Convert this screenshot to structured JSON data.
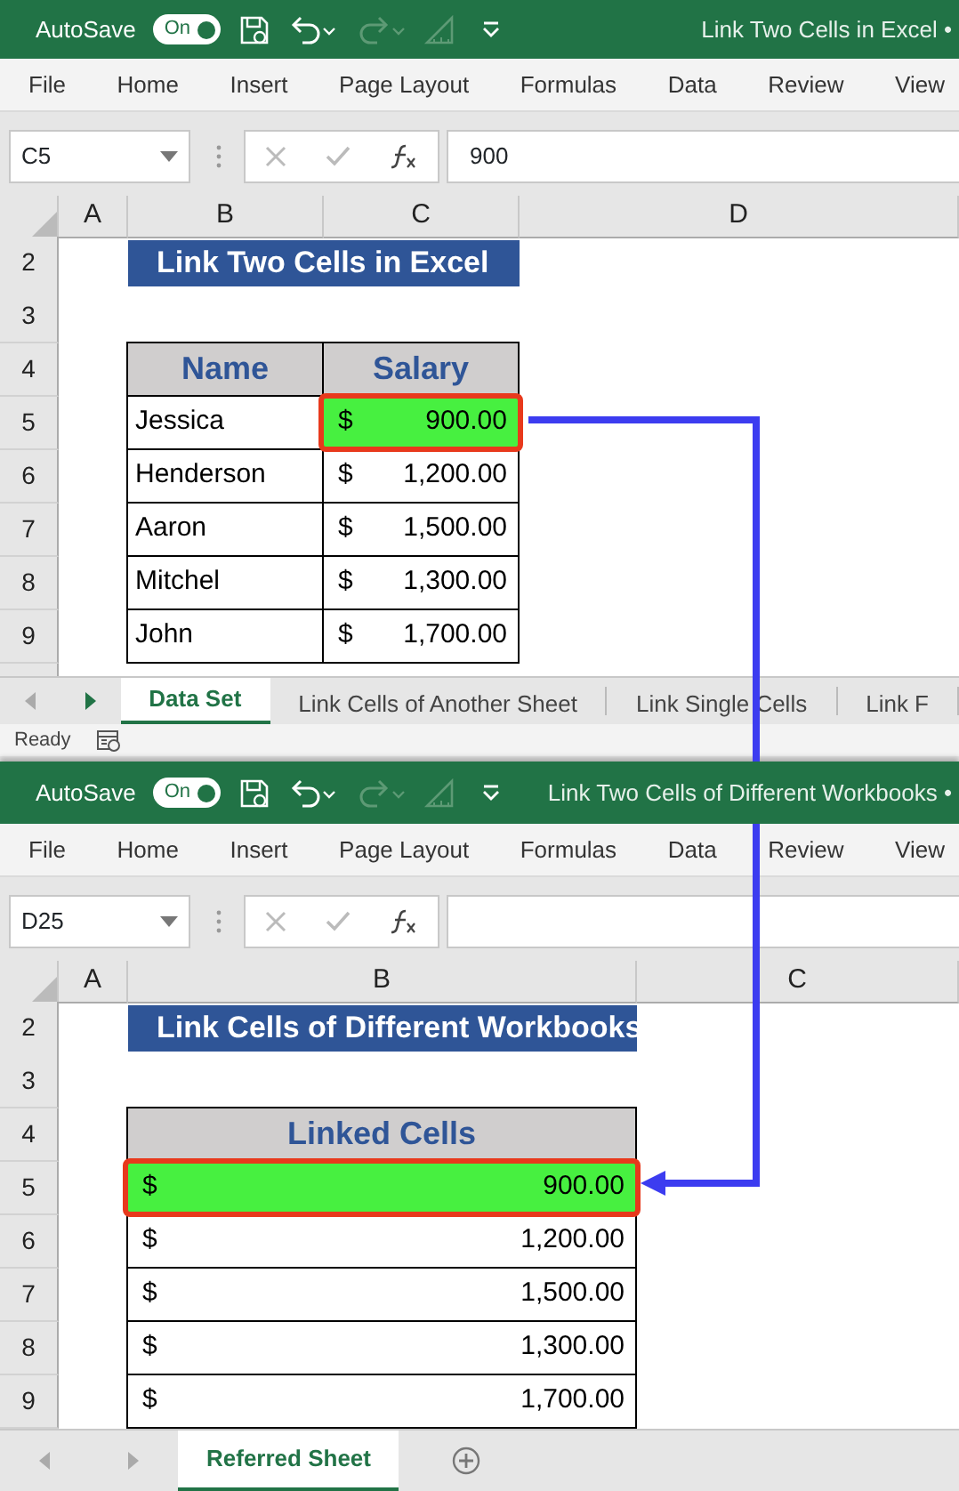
{
  "windows": [
    {
      "title_bar": {
        "autosave_label": "AutoSave",
        "autosave_state": "On",
        "autosave_on": true,
        "title": "Link Two Cells in Excel •"
      },
      "menu": [
        "File",
        "Home",
        "Insert",
        "Page Layout",
        "Formulas",
        "Data",
        "Review",
        "View"
      ],
      "name_box": "C5",
      "formula": "900",
      "columns": [
        "A",
        "B",
        "C",
        "D"
      ],
      "rows": [
        {
          "number": "2",
          "cells": [
            {
              "kind": "banner",
              "text": "Link Two Cells in Excel"
            }
          ]
        },
        {
          "number": "3",
          "cells": []
        },
        {
          "number": "4",
          "cells": [
            {
              "kind": "header",
              "text": "Name"
            },
            {
              "kind": "header",
              "text": "Salary"
            }
          ]
        },
        {
          "number": "5",
          "cells": [
            {
              "kind": "text",
              "text": "Jessica"
            },
            {
              "kind": "currency",
              "symbol": "$",
              "amount": "900.00",
              "selected": true
            }
          ]
        },
        {
          "number": "6",
          "cells": [
            {
              "kind": "text",
              "text": "Henderson"
            },
            {
              "kind": "currency",
              "symbol": "$",
              "amount": "1,200.00",
              "selected": false
            }
          ]
        },
        {
          "number": "7",
          "cells": [
            {
              "kind": "text",
              "text": "Aaron"
            },
            {
              "kind": "currency",
              "symbol": "$",
              "amount": "1,500.00",
              "selected": false
            }
          ]
        },
        {
          "number": "8",
          "cells": [
            {
              "kind": "text",
              "text": "Mitchel"
            },
            {
              "kind": "currency",
              "symbol": "$",
              "amount": "1,300.00",
              "selected": false
            }
          ]
        },
        {
          "number": "9",
          "cells": [
            {
              "kind": "text",
              "text": "John"
            },
            {
              "kind": "currency",
              "symbol": "$",
              "amount": "1,700.00",
              "selected": false
            }
          ]
        }
      ],
      "sheet_tabs": [
        {
          "label": "Data Set",
          "selected": true
        },
        {
          "label": "Link Cells of Another Sheet",
          "selected": false
        },
        {
          "label": "Link Single Cells",
          "selected": false
        },
        {
          "label": "Link F",
          "selected": false
        }
      ],
      "status": "Ready"
    },
    {
      "title_bar": {
        "autosave_label": "AutoSave",
        "autosave_state": "On",
        "autosave_on": true,
        "title": "Link Two Cells of Different Workbooks •"
      },
      "menu": [
        "File",
        "Home",
        "Insert",
        "Page Layout",
        "Formulas",
        "Data",
        "Review",
        "View"
      ],
      "name_box": "D25",
      "columns": [
        "A",
        "B",
        "C"
      ],
      "rows": [
        {
          "number": "2",
          "cells": [
            {
              "kind": "banner",
              "text": "Link Cells of Different Workbooks"
            }
          ]
        },
        {
          "number": "3",
          "cells": []
        },
        {
          "number": "4",
          "cells": [
            {
              "kind": "header",
              "text": "Linked Cells"
            }
          ]
        },
        {
          "number": "5",
          "cells": [
            {
              "kind": "currency",
              "symbol": "$",
              "amount": "900.00",
              "selected": true
            }
          ]
        },
        {
          "number": "6",
          "cells": [
            {
              "kind": "currency",
              "symbol": "$",
              "amount": "1,200.00",
              "selected": false
            }
          ]
        },
        {
          "number": "7",
          "cells": [
            {
              "kind": "currency",
              "symbol": "$",
              "amount": "1,500.00",
              "selected": false
            }
          ]
        },
        {
          "number": "8",
          "cells": [
            {
              "kind": "currency",
              "symbol": "$",
              "amount": "1,300.00",
              "selected": false
            }
          ]
        },
        {
          "number": "9",
          "cells": [
            {
              "kind": "currency",
              "symbol": "$",
              "amount": "1,700.00",
              "selected": false
            }
          ]
        }
      ],
      "sheet_tabs": [
        {
          "label": "Referred Sheet",
          "selected": true
        }
      ],
      "add_sheet": true
    }
  ]
}
